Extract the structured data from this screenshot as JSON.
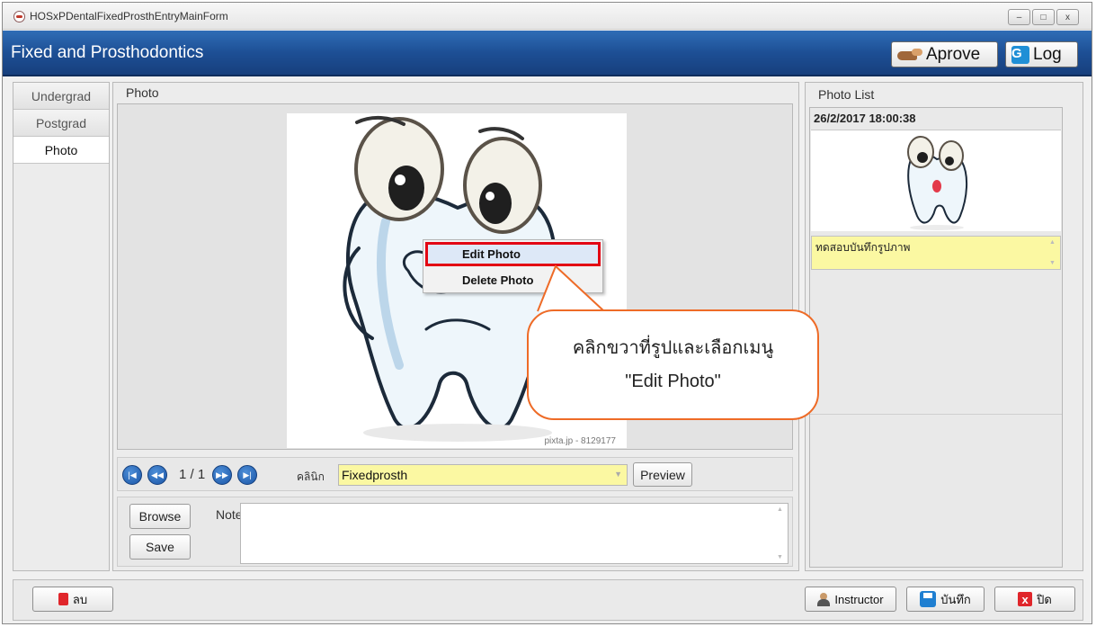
{
  "window": {
    "title": "HOSxPDentalFixedProsthEntryMainForm",
    "controls": {
      "minimize": "‒",
      "maximize": "□",
      "close": "x"
    }
  },
  "header": {
    "title": "Fixed and Prosthodontics",
    "approve_label": "Aprove",
    "log_label": "Log",
    "log_icon_glyph": "G"
  },
  "sidetabs": [
    {
      "label": "Undergrad"
    },
    {
      "label": "Postgrad"
    },
    {
      "label": "Photo"
    }
  ],
  "photo_panel": {
    "title": "Photo",
    "watermark": "pixta.jp - 8129177",
    "context_menu": [
      "Edit Photo",
      "Delete Photo"
    ],
    "callout_line1": "คลิกขวาที่รูปและเลือกเมนู",
    "callout_line2": "\"Edit Photo\"",
    "pager": "1 / 1",
    "nav_glyphs": {
      "first": "|◀",
      "prev": "◀◀",
      "next": "▶▶",
      "last": "▶|"
    },
    "clinic_label": "คลินิก",
    "clinic_value": "Fixedprosth",
    "preview_label": "Preview",
    "browse_label": "Browse",
    "save_label": "Save",
    "note_label": "Note",
    "note_value": ""
  },
  "photo_list": {
    "title": "Photo List",
    "items": [
      {
        "date": "26/2/2017 18:00:38",
        "note": "ทดสอบบันทึกรูปภาพ"
      }
    ]
  },
  "footer": {
    "delete_label": "ลบ",
    "instructor_label": "Instructor",
    "save_label": "บันทึก",
    "close_label": "ปิด",
    "close_glyph": "x"
  },
  "colors": {
    "header_blue": "#1d4f95",
    "highlight_red": "#e30613",
    "callout_orange": "#ee6b27",
    "field_yellow": "#fbf8a2"
  }
}
